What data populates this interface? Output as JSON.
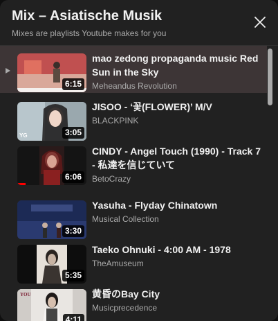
{
  "header": {
    "title": "Mix – Asiatische Musik",
    "subtitle": "Mixes are playlists Youtube makes for you",
    "close_icon": "close-icon"
  },
  "playlist": {
    "items": [
      {
        "title": "mao zedong propaganda music Red Sun in the Sky",
        "channel": "Meheandus Revolution",
        "duration": "6:15",
        "active": true
      },
      {
        "title": "JISOO - ‘꽃(FLOWER)’ M/V",
        "channel": "BLACKPINK",
        "duration": "3:05",
        "active": false
      },
      {
        "title": "CINDY - Angel Touch (1990) - Track 7 - 私達を信じていて",
        "channel": "BetoCrazy",
        "duration": "6:06",
        "active": false
      },
      {
        "title": "Yasuha - Flyday Chinatown",
        "channel": "Musical Collection",
        "duration": "3:30",
        "active": false
      },
      {
        "title": "Taeko Ohnuki - 4:00 AM - 1978",
        "channel": "TheAmuseum",
        "duration": "5:35",
        "active": false
      },
      {
        "title": "黄昏のBay City",
        "channel": "Musicprecedence",
        "duration": "4:11",
        "active": false
      }
    ]
  },
  "colors": {
    "panel_bg": "#212121",
    "active_row_bg": "#3d3536",
    "progress_red": "#ff0000",
    "text_primary": "#f1f1f1",
    "text_secondary": "#aaaaaa"
  }
}
